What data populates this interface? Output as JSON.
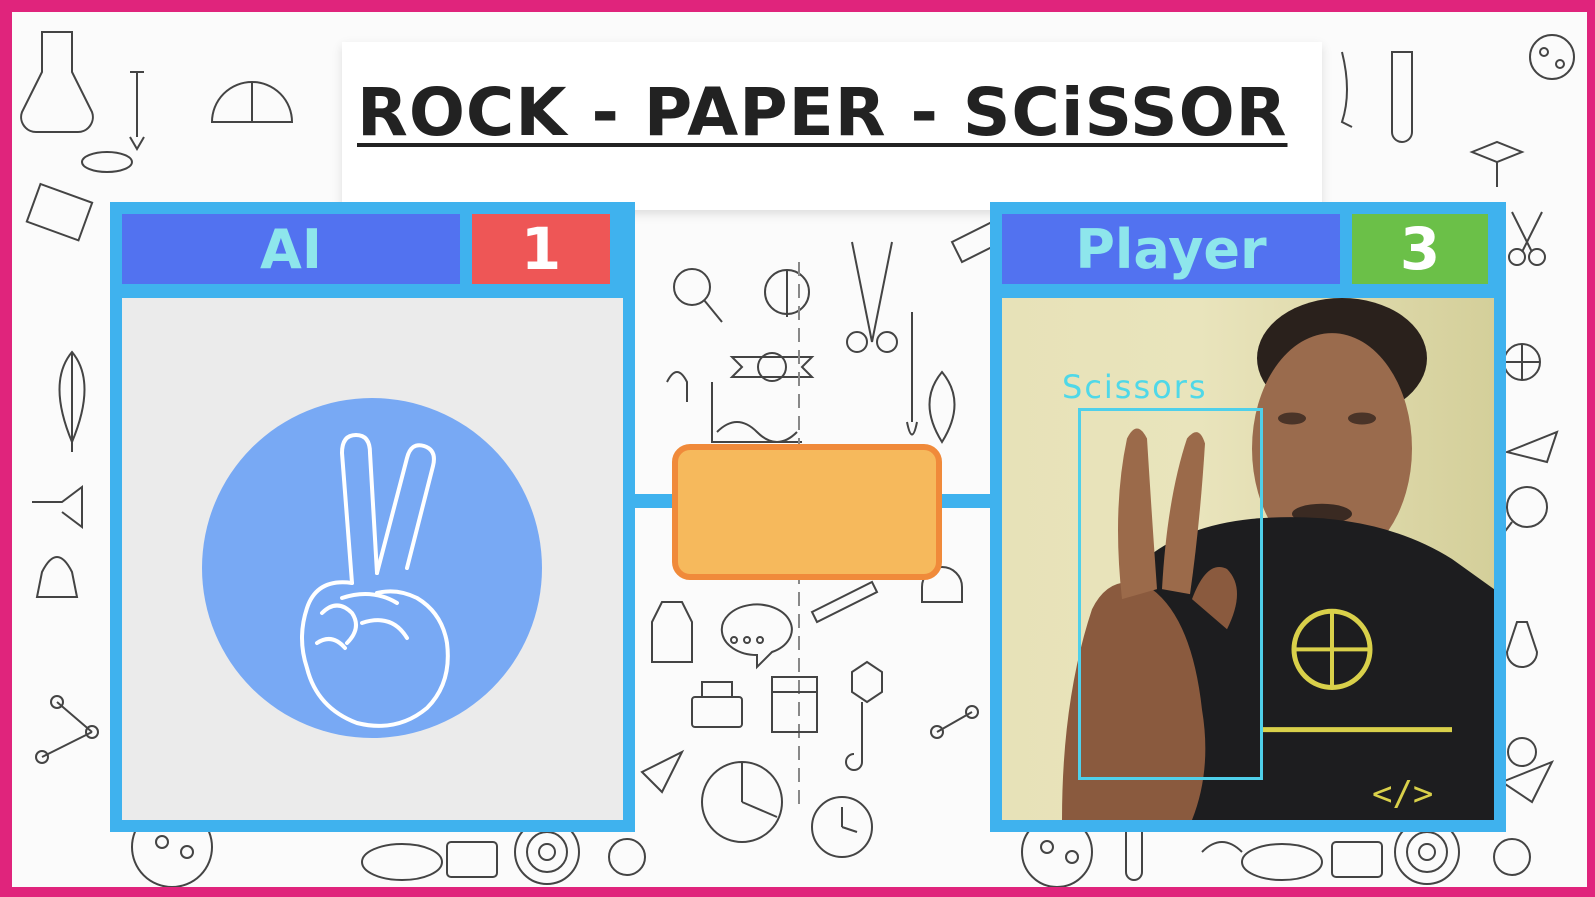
{
  "game": {
    "title": "ROCK - PAPER - SCiSSOR"
  },
  "ai": {
    "label": "AI",
    "score": "1",
    "move_icon": "peace-hand-icon"
  },
  "player": {
    "label": "Player",
    "score": "3",
    "detected_gesture": "Scissors"
  },
  "colors": {
    "frame": "#e0247c",
    "panel_border": "#3fb2ee",
    "header_bg": "#5272f0",
    "header_text": "#8ee6ec",
    "ai_score_bg": "#ee5656",
    "player_score_bg": "#6bc048",
    "result_box": "#f6b95c",
    "result_border": "#f08a3a",
    "ai_circle": "#78a9f4"
  }
}
